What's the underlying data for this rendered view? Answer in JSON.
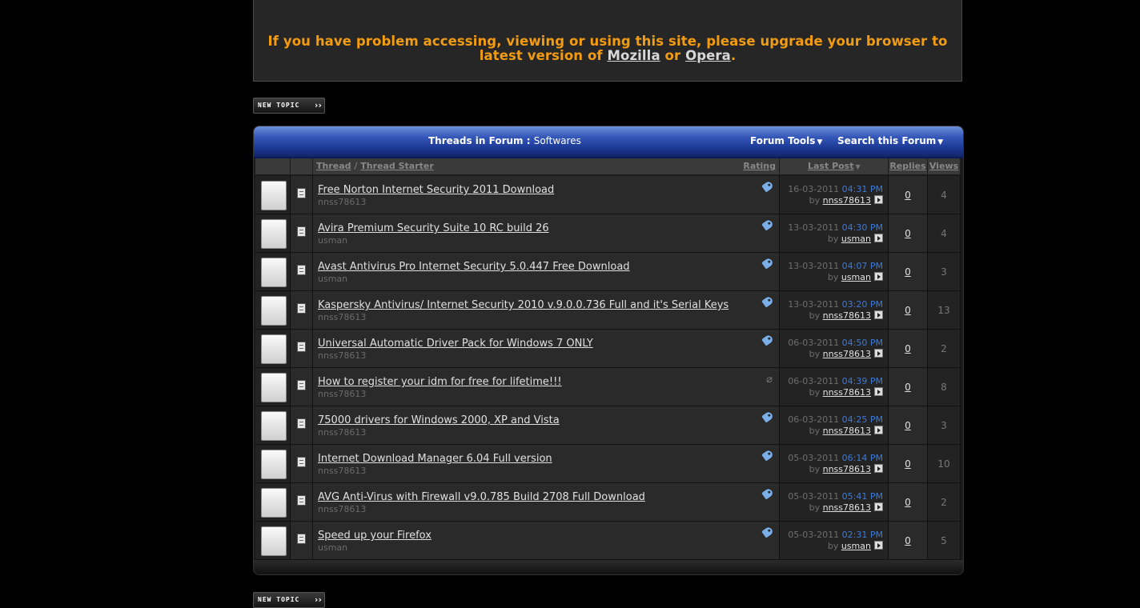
{
  "notice": {
    "text_before": "If you have problem accessing, viewing or using this site, please upgrade your browser to latest version of ",
    "link1": "Mozilla",
    "text_mid": " or ",
    "link2": "Opera",
    "text_after": "."
  },
  "buttons": {
    "new_topic": "New Topic"
  },
  "forum_header": {
    "label": "Threads in Forum",
    "separator": " : ",
    "forum_name": "Softwares",
    "tools": "Forum Tools",
    "search": "Search this Forum"
  },
  "columns": {
    "thread": "Thread",
    "slash": "/",
    "starter": "Thread Starter",
    "rating": "Rating",
    "last_post": "Last Post",
    "replies": "Replies",
    "views": "Views"
  },
  "by_label": "by",
  "threads": [
    {
      "title": "Free Norton Internet Security 2011 Download",
      "starter": "nnss78613",
      "icon": "tag-icon",
      "date": "16-03-2011",
      "time": "04:31 PM",
      "user": "nnss78613",
      "replies": "0",
      "views": "4"
    },
    {
      "title": "Avira Premium Security Suite 10 RC build 26",
      "starter": "usman",
      "icon": "tag-icon",
      "date": "13-03-2011",
      "time": "04:30 PM",
      "user": "usman",
      "replies": "0",
      "views": "4"
    },
    {
      "title": "Avast Antivirus Pro Internet Security 5.0.447 Free Download",
      "starter": "usman",
      "icon": "tag-icon",
      "date": "13-03-2011",
      "time": "04:07 PM",
      "user": "usman",
      "replies": "0",
      "views": "3"
    },
    {
      "title": "Kaspersky Antivirus/ Internet Security 2010 v.9.0.0.736 Full and it's Serial Keys",
      "starter": "nnss78613",
      "icon": "tag-icon",
      "date": "13-03-2011",
      "time": "03:20 PM",
      "user": "nnss78613",
      "replies": "0",
      "views": "13"
    },
    {
      "title": "Universal Automatic Driver Pack for Windows 7 ONLY",
      "starter": "nnss78613",
      "icon": "tag-icon",
      "date": "06-03-2011",
      "time": "04:50 PM",
      "user": "nnss78613",
      "replies": "0",
      "views": "2"
    },
    {
      "title": "How to register your idm for free for lifetime!!!",
      "starter": "nnss78613",
      "icon": "paperclip-icon",
      "date": "06-03-2011",
      "time": "04:39 PM",
      "user": "nnss78613",
      "replies": "0",
      "views": "8"
    },
    {
      "title": "75000 drivers for Windows 2000, XP and Vista",
      "starter": "nnss78613",
      "icon": "tag-icon",
      "date": "06-03-2011",
      "time": "04:25 PM",
      "user": "nnss78613",
      "replies": "0",
      "views": "3"
    },
    {
      "title": "Internet Download Manager 6.04 Full version",
      "starter": "nnss78613",
      "icon": "tag-icon",
      "date": "05-03-2011",
      "time": "06:14 PM",
      "user": "nnss78613",
      "replies": "0",
      "views": "10"
    },
    {
      "title": "AVG Anti-Virus with Firewall v9.0.785 Build 2708 Full Download",
      "starter": "nnss78613",
      "icon": "tag-icon",
      "date": "05-03-2011",
      "time": "05:41 PM",
      "user": "nnss78613",
      "replies": "0",
      "views": "2"
    },
    {
      "title": "Speed up your Firefox",
      "starter": "usman",
      "icon": "tag-icon",
      "date": "05-03-2011",
      "time": "02:31 PM",
      "user": "usman",
      "replies": "0",
      "views": "5"
    }
  ],
  "colors": {
    "notice_text": "#f39c12",
    "time_text": "#3f79d6",
    "header_blue": "#1d3a96"
  }
}
